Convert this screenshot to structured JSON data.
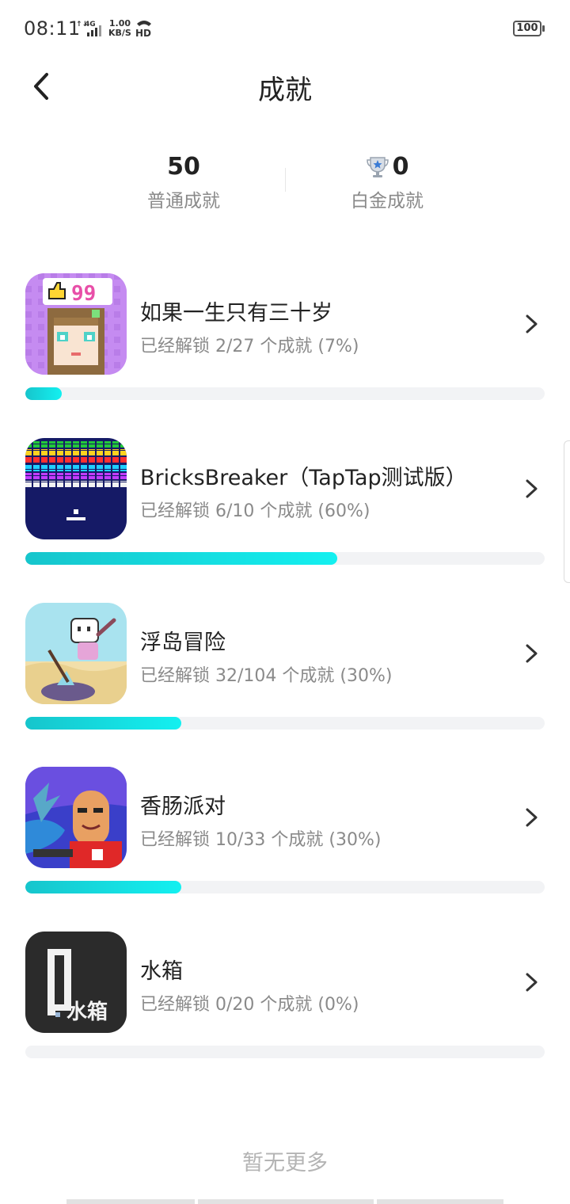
{
  "status_bar": {
    "time": "08:11",
    "network": "4G",
    "speed_value": "1.00",
    "speed_unit": "KB/S",
    "hd": "HD",
    "battery": "100"
  },
  "header": {
    "title": "成就",
    "back_icon": "chevron-left-icon"
  },
  "summary": {
    "normal_count": "50",
    "normal_label": "普通成就",
    "platinum_count": "0",
    "platinum_label": "白金成就",
    "platinum_icon": "trophy-icon"
  },
  "games": [
    {
      "name": "如果一生只有三十岁",
      "progress_text": "已经解锁 2/27 个成就 (7%)",
      "progress": 0.07,
      "icon": "pixel-girl-thumbs-99"
    },
    {
      "name": "BricksBreaker（TapTap测试版）",
      "progress_text": "已经解锁 6/10 个成就 (60%)",
      "progress": 0.6,
      "icon": "brick-wall-paddle"
    },
    {
      "name": "浮岛冒险",
      "progress_text": "已经解锁 32/104 个成就 (30%)",
      "progress": 0.3,
      "icon": "cube-hero-pickaxe"
    },
    {
      "name": "香肠派对",
      "progress_text": "已经解锁 10/33 个成就 (30%)",
      "progress": 0.3,
      "icon": "sausage-character"
    },
    {
      "name": "水箱",
      "progress_text": "已经解锁 0/20 个成就 (0%)",
      "progress": 0.0,
      "icon": "water-tank-logo",
      "icon_text": "水箱"
    }
  ],
  "footer": {
    "no_more": "暂无更多"
  },
  "colors": {
    "progress_start": "#16c5cc",
    "progress_end": "#14f0f0",
    "track": "#f2f3f5",
    "secondary_text": "#8a8a8a"
  }
}
